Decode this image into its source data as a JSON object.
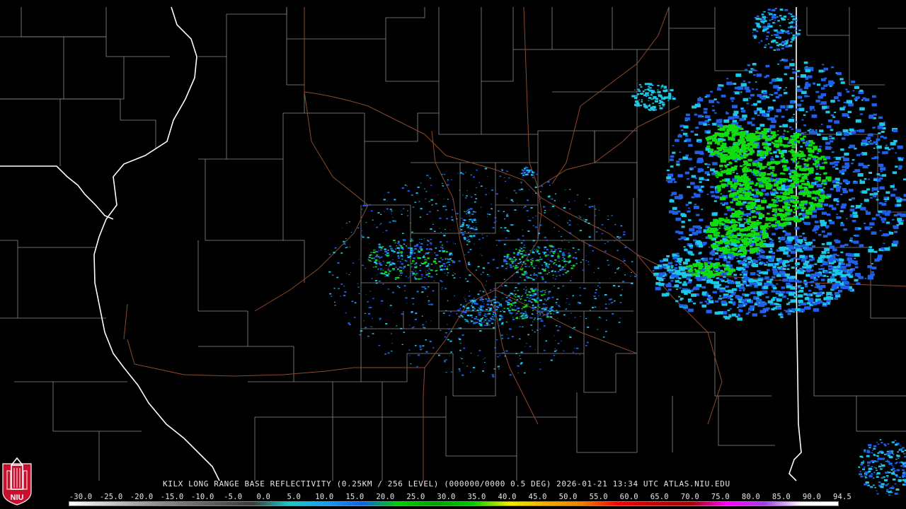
{
  "product": {
    "title": "KILX LONG RANGE BASE REFLECTIVITY (0.25KM / 256 LEVEL) (000000/0000 0.5 DEG) 2026-01-21 13:34 UTC  ATLAS.NIU.EDU"
  },
  "logo": {
    "text": "NIU",
    "icon": "niu-tower-logo-icon",
    "colors": {
      "shield": "#c8102e",
      "tower": "#ffffff"
    }
  },
  "colorbar": {
    "labels": [
      "-30.0",
      "-25.0",
      "-20.0",
      "-15.0",
      "-10.0",
      "-5.0",
      "0.0",
      "5.0",
      "10.0",
      "15.0",
      "20.0",
      "25.0",
      "30.0",
      "35.0",
      "40.0",
      "45.0",
      "50.0",
      "55.0",
      "60.0",
      "65.0",
      "70.0",
      "75.0",
      "80.0",
      "85.0",
      "90.0",
      "94.5"
    ],
    "stops": [
      "#ffffff",
      "#cfcfcf",
      "#a0a0a0",
      "#7a7a7a",
      "#5a5a5a",
      "#3a3a3a",
      "#1cc8c8",
      "#1a9cf0",
      "#1060e0",
      "#00d000",
      "#00a000",
      "#00c800",
      "#f0f000",
      "#f0b000",
      "#f08000",
      "#f00000",
      "#c00000",
      "#a00000",
      "#ff00ff",
      "#a040e0",
      "#ffffff",
      "#ffffff"
    ]
  },
  "map": {
    "colors": {
      "background": "#000000",
      "county": "#8a8a8a",
      "state": "#ffffff",
      "road": "#8c4a2c",
      "echo_light": "#1cc8e8",
      "echo_mid": "#2060e8",
      "echo_heavy": "#10dc10"
    }
  }
}
